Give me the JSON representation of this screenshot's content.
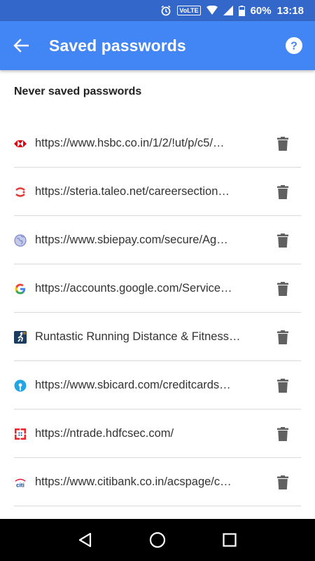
{
  "status_bar": {
    "volte": "VoLTE",
    "battery": "60%",
    "time": "13:18"
  },
  "app_bar": {
    "title": "Saved passwords",
    "back_icon": "arrow-back-icon",
    "help_icon": "help-icon"
  },
  "section": {
    "header": "Never saved passwords"
  },
  "items": [
    {
      "text": "https://www.hsbc.co.in/1/2/!ut/p/c5/…",
      "icon": "hsbc-favicon"
    },
    {
      "text": "https://steria.taleo.net/careersection…",
      "icon": "taleo-favicon"
    },
    {
      "text": "https://www.sbiepay.com/secure/Ag…",
      "icon": "globe-favicon"
    },
    {
      "text": "https://accounts.google.com/Service…",
      "icon": "google-favicon"
    },
    {
      "text": "Runtastic Running Distance & Fitness…",
      "icon": "runtastic-favicon"
    },
    {
      "text": "https://www.sbicard.com/creditcards…",
      "icon": "sbi-favicon"
    },
    {
      "text": "https://ntrade.hdfcsec.com/",
      "icon": "hdfc-favicon"
    },
    {
      "text": "https://www.citibank.co.in/acspage/c…",
      "icon": "citi-favicon"
    }
  ],
  "colors": {
    "status_bar": "#3367c9",
    "app_bar": "#4285f4",
    "trash": "#616161"
  }
}
